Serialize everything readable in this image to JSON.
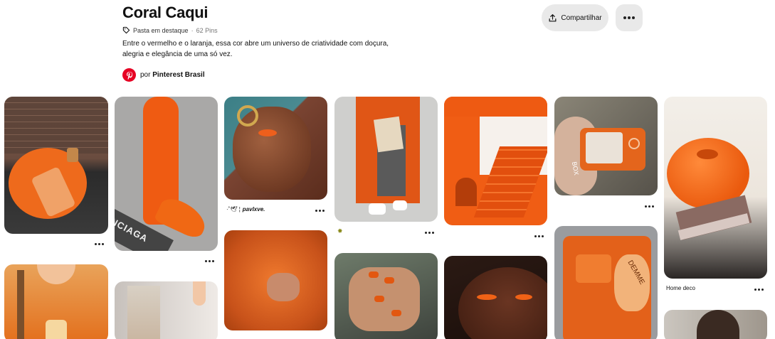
{
  "board": {
    "title": "Coral Caqui",
    "featured_label": "Pasta em destaque",
    "separator": "·",
    "pin_count": "62 Pins",
    "description": "Entre o vermelho e o laranja, essa cor abre um universo de criatividade com doçura, alegria e elegância de uma só vez.",
    "by_prefix": "por",
    "owner": "Pinterest Brasil"
  },
  "actions": {
    "share_label": "Compartilhar",
    "more_icon": "ellipsis-icon",
    "share_icon": "share-upload-icon"
  },
  "pins": {
    "shoe_text": "NCIAGA",
    "pin3_caption": "pavlxve.",
    "pin3_emoji": "·˚🕊 ¦",
    "pin7_caption": "Home deco",
    "pin10_text": "DEMME",
    "pin_camera_text": "BOX"
  },
  "colors": {
    "accent": "#e60023",
    "coral": "#f06a1e",
    "button_bg": "#e9e9e9"
  }
}
